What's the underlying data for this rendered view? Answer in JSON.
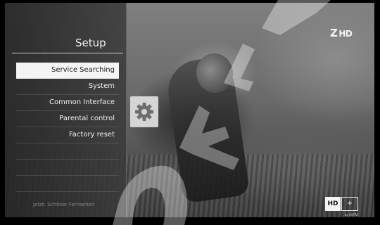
{
  "panel": {
    "title": "Setup",
    "menu": [
      {
        "label": "Service Searching",
        "selected": true
      },
      {
        "label": "System",
        "selected": false
      },
      {
        "label": "Common Interface",
        "selected": false
      },
      {
        "label": "Parental control",
        "selected": false
      },
      {
        "label": "Factory reset",
        "selected": false
      }
    ],
    "now_playing": "Jetzt: Schöner Fernsehen"
  },
  "channel_logo": {
    "symbol": "Z",
    "text": "HD"
  },
  "hdplus_badge": {
    "hd": "HD",
    "plus": "+",
    "small": "by ASTRA"
  },
  "settings_icon": "gear-icon",
  "watermark": {
    "text": "OWL",
    "color": "#ffffff"
  }
}
